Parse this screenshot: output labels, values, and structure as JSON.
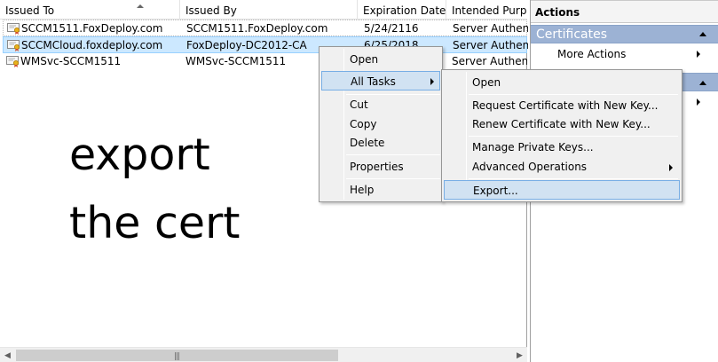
{
  "columns": [
    "Issued To",
    "Issued By",
    "Expiration Date",
    "Intended Purpo"
  ],
  "rows": [
    {
      "issued_to": "SCCM1511.FoxDeploy.com",
      "issued_by": "SCCM1511.FoxDeploy.com",
      "expiration": "5/24/2116",
      "purpose": "Server Authenti"
    },
    {
      "issued_to": "SCCMCloud.foxdeploy.com",
      "issued_by": "FoxDeploy-DC2012-CA",
      "expiration": "6/25/2018",
      "purpose": "Server Authenti"
    },
    {
      "issued_to": "WMSvc-SCCM1511",
      "issued_by": "WMSvc-SCCM1511",
      "expiration": "",
      "purpose": "Server Authenti"
    }
  ],
  "overlay": {
    "line1": "export",
    "line2": "the cert"
  },
  "actions": {
    "title": "Actions",
    "section": "Certificates",
    "more_actions": "More Actions"
  },
  "context_menu": {
    "open": "Open",
    "all_tasks": "All Tasks",
    "cut": "Cut",
    "copy": "Copy",
    "delete": "Delete",
    "properties": "Properties",
    "help": "Help"
  },
  "submenu": {
    "open": "Open",
    "request_new_key": "Request Certificate with New Key...",
    "renew_new_key": "Renew Certificate with New Key...",
    "manage_private_keys": "Manage Private Keys...",
    "advanced_operations": "Advanced Operations",
    "export": "Export..."
  },
  "colors": {
    "selection": "#cce8ff",
    "menu_highlight": "#d1e2f2",
    "actions_section": "#9cb2d4"
  }
}
